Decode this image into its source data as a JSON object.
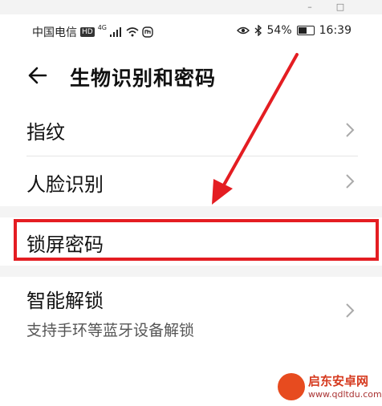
{
  "window": {
    "minimize": "–",
    "maximize": "□"
  },
  "status_bar": {
    "carrier": "中国电信",
    "hd": "HD",
    "network": "4G",
    "battery_percent": "54%",
    "battery_level": 0.54,
    "time": "16:39"
  },
  "header": {
    "title": "生物识别和密码"
  },
  "items": [
    {
      "label": "指纹"
    },
    {
      "label": "人脸识别"
    },
    {
      "label": "锁屏密码"
    },
    {
      "label": "智能解锁",
      "subtitle": "支持手环等蓝牙设备解锁"
    }
  ],
  "watermark": {
    "title": "启东安卓网",
    "url": "www.qdltdu.com"
  },
  "colors": {
    "highlight": "#e41d22",
    "section_gap": "#f4f4f4"
  }
}
